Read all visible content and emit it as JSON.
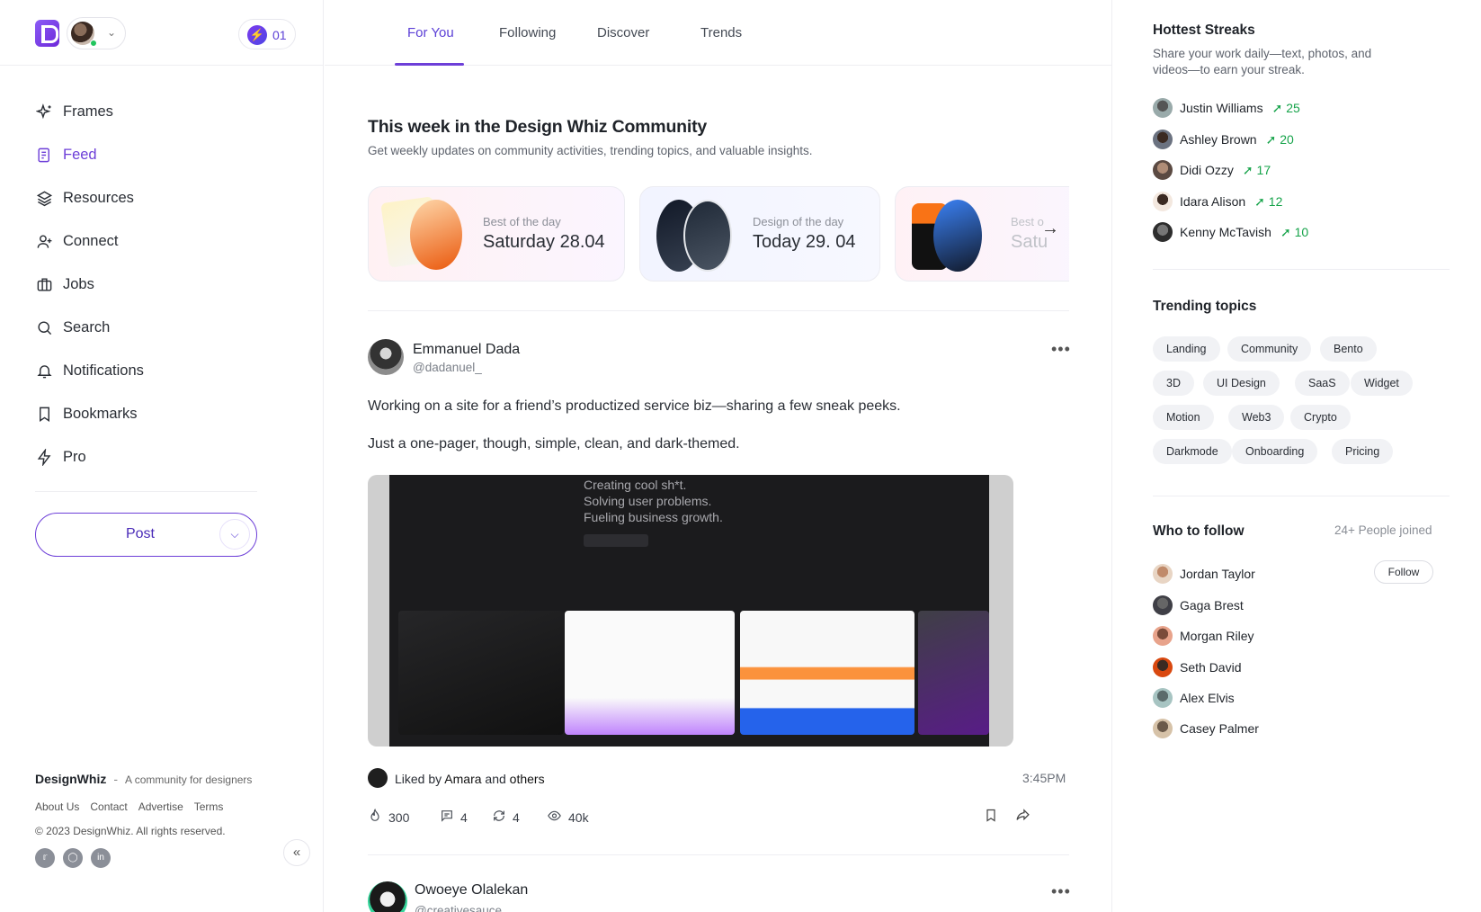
{
  "header": {
    "streak_count": "01"
  },
  "nav": {
    "items": [
      {
        "label": "Frames",
        "icon": "sparkles-icon"
      },
      {
        "label": "Feed",
        "icon": "feed-icon",
        "active": true
      },
      {
        "label": "Resources",
        "icon": "layers-icon"
      },
      {
        "label": "Connect",
        "icon": "user-plus-icon"
      },
      {
        "label": "Jobs",
        "icon": "briefcase-icon"
      },
      {
        "label": "Search",
        "icon": "search-icon"
      },
      {
        "label": "Notifications",
        "icon": "bell-icon"
      },
      {
        "label": "Bookmarks",
        "icon": "bookmark-icon"
      },
      {
        "label": "Pro",
        "icon": "bolt-icon"
      }
    ],
    "post_label": "Post"
  },
  "footer": {
    "brand": "DesignWhiz",
    "dash": "-",
    "tagline": "A community for designers",
    "links": [
      "About Us",
      "Contact",
      "Advertise",
      "Terms"
    ],
    "copyright": "© 2023 DesignWhiz. All rights reserved."
  },
  "tabs": [
    "For You",
    "Following",
    "Discover",
    "Trends"
  ],
  "weekly": {
    "title": "This week in the Design Whiz Community",
    "subtitle": "Get weekly updates on community activities, trending topics, and valuable insights.",
    "cards": [
      {
        "kicker": "Best of the day",
        "value": "Saturday 28.04"
      },
      {
        "kicker": "Design of the day",
        "value": "Today 29. 04"
      },
      {
        "kicker": "Best o",
        "value": "Satu"
      }
    ]
  },
  "post": {
    "author": "Emmanuel Dada",
    "handle": "@dadanuel_",
    "text1": "Working on a site for a friend’s productized service biz—sharing a few sneak peeks.",
    "text2": "Just a one-pager, though, simple, clean, and dark-themed.",
    "image_lines": [
      "Creating cool sh*t.",
      "Solving user problems.",
      "Fueling business growth."
    ],
    "liked_prefix": "Liked by",
    "liked_name": "Amara",
    "liked_and": "and",
    "liked_others": "others",
    "time": "3:45PM",
    "likes": "300",
    "comments": "4",
    "reposts": "4",
    "views": "40k"
  },
  "post2": {
    "author": "Owoeye Olalekan",
    "handle": "@creativesauce"
  },
  "streaks": {
    "title": "Hottest Streaks",
    "subtitle": "Share your work daily—text, photos, and videos—to earn your streak.",
    "people": [
      {
        "name": "Justin Williams",
        "count": "25"
      },
      {
        "name": "Ashley Brown",
        "count": "20"
      },
      {
        "name": "Didi Ozzy",
        "count": "17"
      },
      {
        "name": "Idara Alison",
        "count": "12"
      },
      {
        "name": "Kenny McTavish",
        "count": "10"
      }
    ]
  },
  "trending": {
    "title": "Trending topics",
    "topics": [
      "Landing",
      "Community",
      "Bento",
      "3D",
      "UI Design",
      "SaaS",
      "Widget",
      "Motion",
      "Web3",
      "Crypto",
      "Darkmode",
      "Onboarding",
      "Pricing"
    ]
  },
  "follow": {
    "title": "Who to follow",
    "joined": "24+ People joined",
    "button": "Follow",
    "people": [
      "Jordan Taylor",
      "Gaga Brest",
      "Morgan Riley",
      "Seth David",
      "Alex Elvis",
      "Casey Palmer"
    ]
  },
  "colors": {
    "accent": "#6d3fd8",
    "streak_green": "#16a34a"
  }
}
